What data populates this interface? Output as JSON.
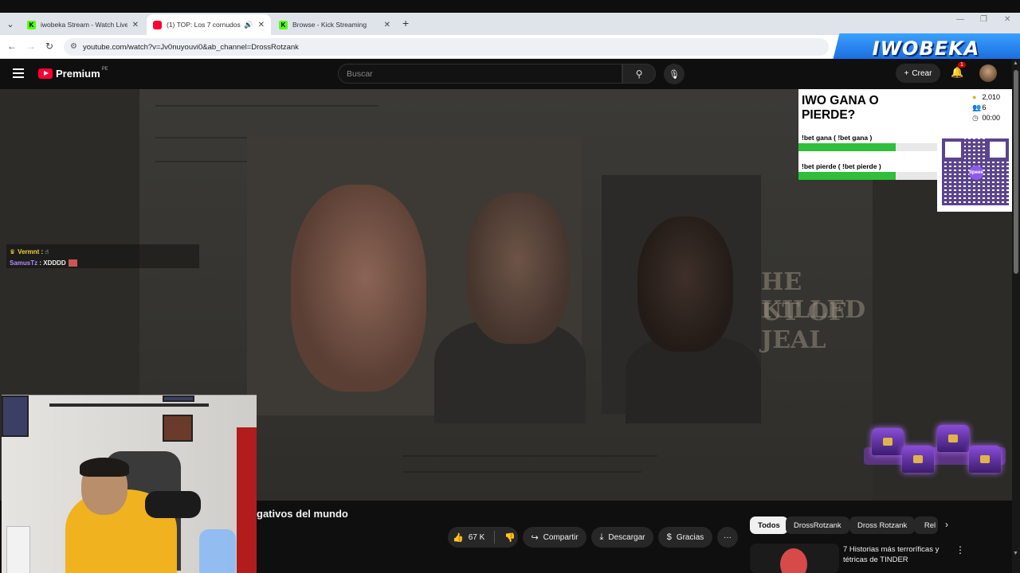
{
  "browser": {
    "tabs": [
      {
        "title": "iwobeka Stream - Watch Live o",
        "favicon": "kick",
        "active": false
      },
      {
        "title": "(1) TOP: Los 7 cornudos (y d",
        "favicon": "youtube",
        "active": true
      },
      {
        "title": "Browse - Kick Streaming",
        "favicon": "kick",
        "active": false
      }
    ],
    "url": "youtube.com/watch?v=Jv0nuyouvi0&ab_channel=DrossRotzank"
  },
  "overlay": {
    "banner": "IWOBEKA",
    "bet_question": "IWO GANA O PIERDE?",
    "option1": "!bet gana ( !bet gana )",
    "option2": "!bet pierde ( !bet pierde )",
    "option1_fill": 0.7,
    "option2_fill": 0.7,
    "stat_points": "2,010",
    "stat_users": "6",
    "stat_timer": "00:00",
    "qr_label": "tipeee"
  },
  "chat": [
    {
      "user": "Vermnt",
      "message": "☝"
    },
    {
      "user": "SamusTz",
      "message": "XDDDD"
    }
  ],
  "youtube": {
    "logo": "Premium",
    "country": "PE",
    "search_placeholder": "Buscar",
    "create_label": "Crear",
    "notif_count": "1",
    "video_title": "gativos del mundo",
    "likes": "67 K",
    "share": "Compartir",
    "download": "Descargar",
    "thanks": "Gracias",
    "chips": [
      "Todos",
      "DrossRotzank",
      "Dross Rotzank",
      "Rel"
    ],
    "rec_title": "7 Historias más terroríficas y tétricas de TINDER"
  },
  "video_headlines": [
    "HE KILLED",
    "UT OF JEAL"
  ]
}
